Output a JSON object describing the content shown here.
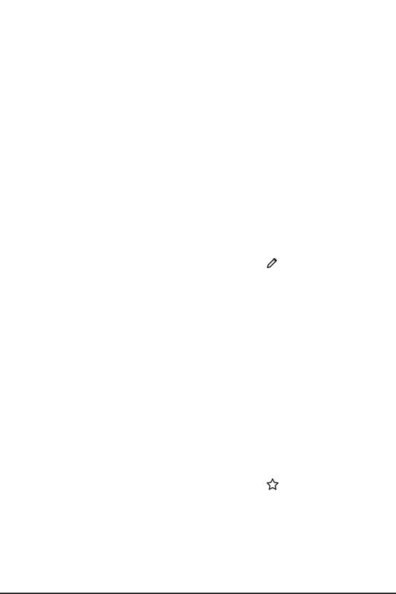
{
  "screen": {
    "background_color": "#ffffff",
    "icon_color": "#222222",
    "bottom_line_color": "#2d2d2d"
  },
  "icons": {
    "edit": "pencil-icon",
    "favorite": "star-outline-icon"
  }
}
